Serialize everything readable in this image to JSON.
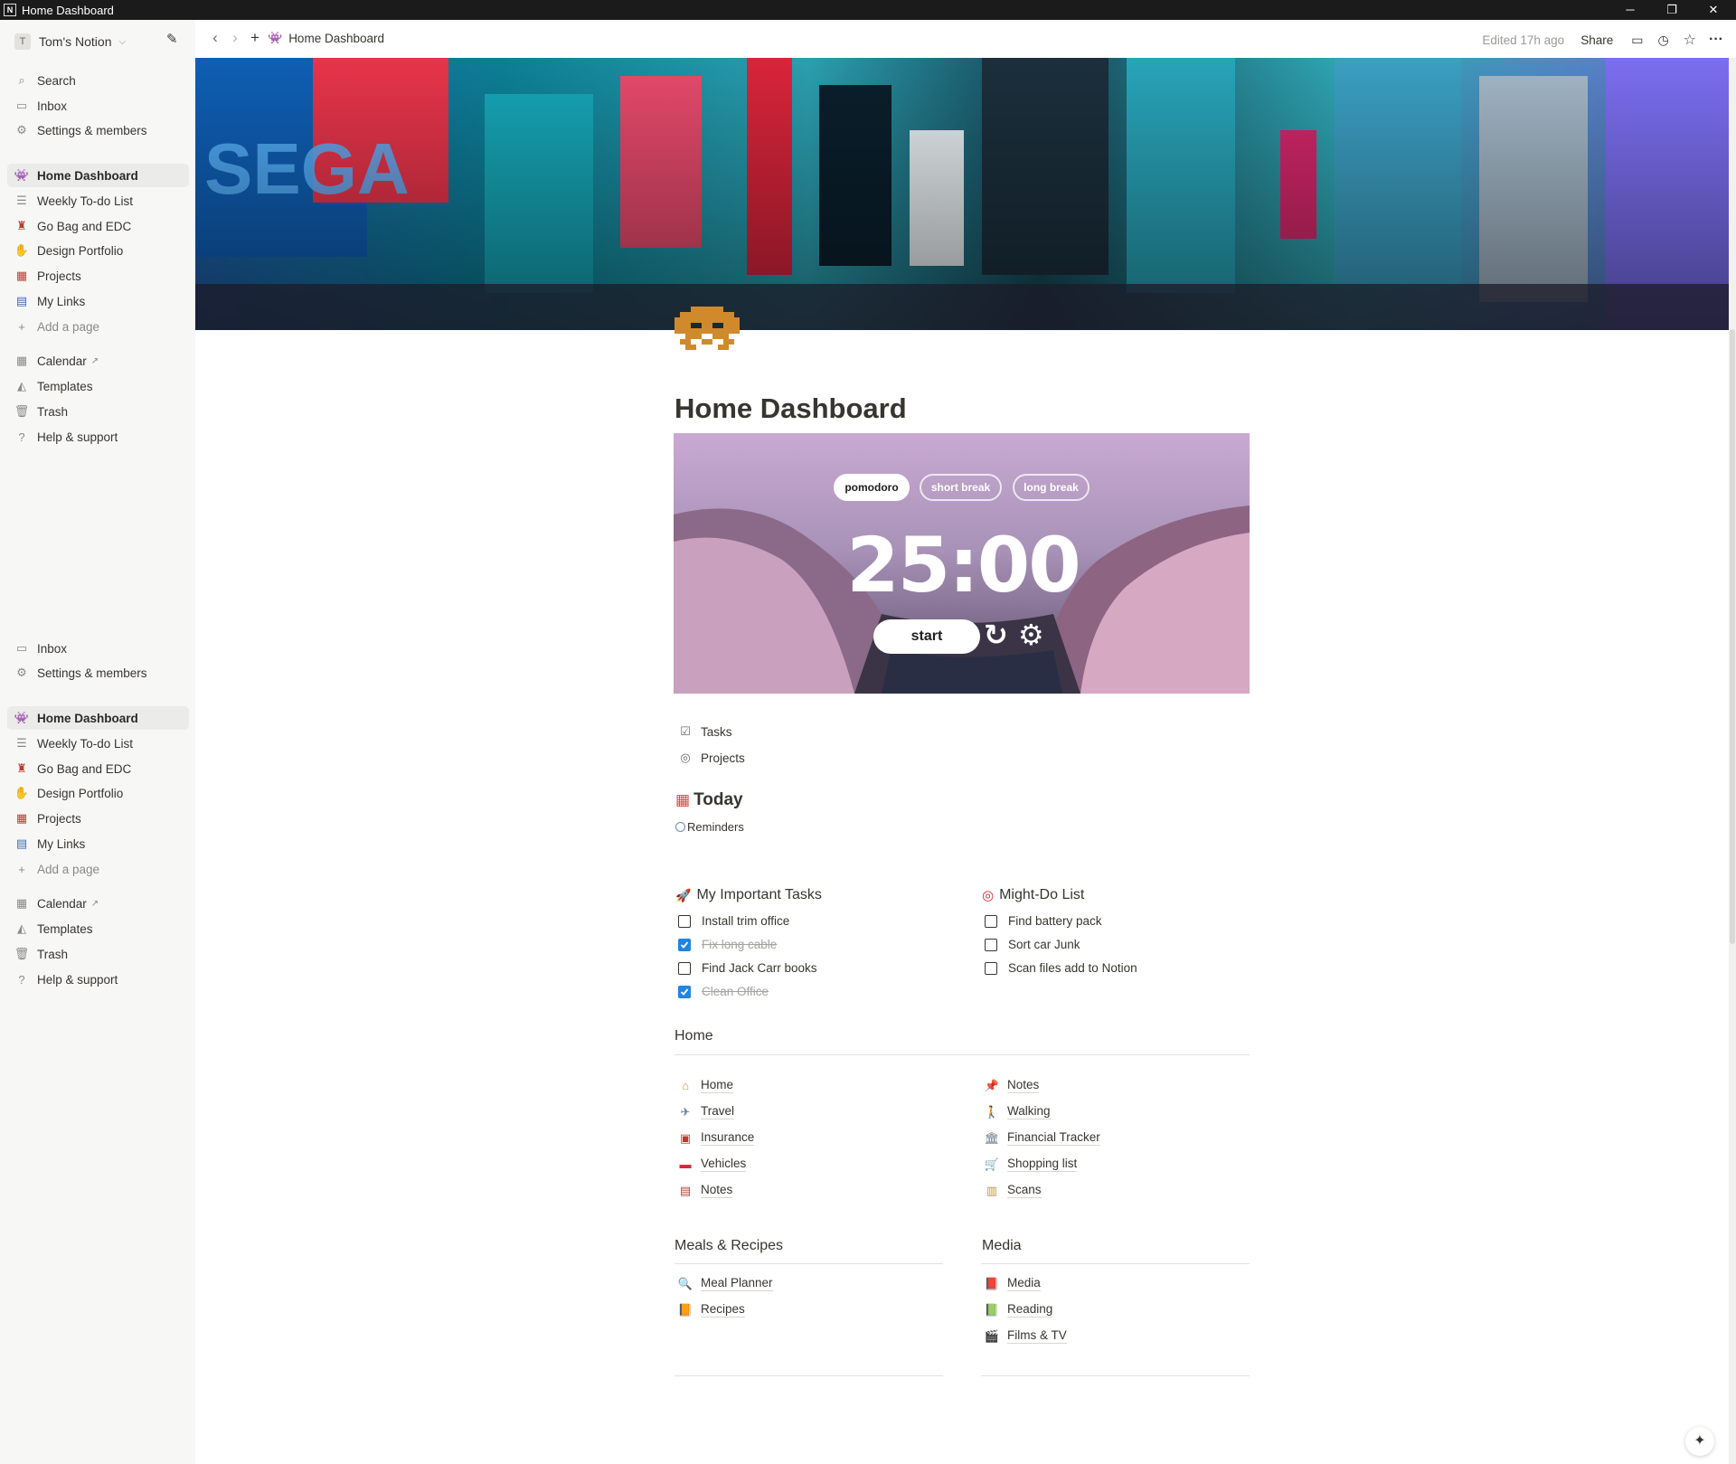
{
  "window": {
    "title": "Home Dashboard",
    "minimize": "─",
    "restore": "❐",
    "close": "✕"
  },
  "sidebar": {
    "workspace": "Tom's Notion",
    "workspace_initial": "T",
    "top": [
      {
        "label": "Search",
        "icon": "search-icon"
      },
      {
        "label": "Inbox",
        "icon": "inbox-icon"
      },
      {
        "label": "Settings & members",
        "icon": "gear-icon"
      }
    ],
    "pages": [
      {
        "label": "Home Dashboard",
        "icon": "space-invader-icon",
        "active": true
      },
      {
        "label": "Weekly To-do List",
        "icon": "list-icon"
      },
      {
        "label": "Go Bag and EDC",
        "icon": "backpack-icon"
      },
      {
        "label": "Design Portfolio",
        "icon": "hand-icon"
      },
      {
        "label": "Projects",
        "icon": "projects-icon"
      },
      {
        "label": "My Links",
        "icon": "links-icon"
      },
      {
        "label": "Add a page",
        "icon": "plus-icon"
      }
    ],
    "bottom": [
      {
        "label": "Calendar",
        "icon": "calendar-icon"
      },
      {
        "label": "Templates",
        "icon": "templates-icon"
      },
      {
        "label": "Trash",
        "icon": "trash-icon"
      },
      {
        "label": "Help & support",
        "icon": "help-icon"
      }
    ],
    "top2": [
      {
        "label": "Inbox",
        "icon": "inbox-icon"
      },
      {
        "label": "Settings & members",
        "icon": "gear-icon"
      }
    ]
  },
  "topbar": {
    "breadcrumb": "Home Dashboard",
    "edited": "Edited 17h ago",
    "share": "Share"
  },
  "page": {
    "title": "Home Dashboard"
  },
  "pomodoro": {
    "modes": [
      "pomodoro",
      "short break",
      "long break"
    ],
    "time": "25:00",
    "start": "start"
  },
  "links_top": [
    {
      "label": "Tasks",
      "icon": "checkbox-icon"
    },
    {
      "label": "Projects",
      "icon": "target-icon"
    }
  ],
  "today": {
    "title": "Today",
    "reminders": "Reminders"
  },
  "important_tasks": {
    "title": "My Important Tasks",
    "items": [
      {
        "label": "Install trim office",
        "checked": false
      },
      {
        "label": "Fix long cable",
        "checked": true
      },
      {
        "label": "Find Jack Carr books",
        "checked": false
      },
      {
        "label": "Clean Office",
        "checked": true
      }
    ]
  },
  "might_do": {
    "title": "Might-Do List",
    "items": [
      {
        "label": "Find battery pack",
        "checked": false
      },
      {
        "label": "Sort car Junk",
        "checked": false
      },
      {
        "label": "Scan files add to Notion",
        "checked": false
      }
    ]
  },
  "home": {
    "title": "Home",
    "left": [
      {
        "label": "Home",
        "icon": "house-icon"
      },
      {
        "label": "Travel",
        "icon": "airplane-icon"
      },
      {
        "label": "Insurance",
        "icon": "briefcase-icon"
      },
      {
        "label": "Vehicles",
        "icon": "car-icon"
      },
      {
        "label": "Notes",
        "icon": "notebook-icon"
      }
    ],
    "right": [
      {
        "label": "Notes",
        "icon": "pushpin-icon"
      },
      {
        "label": "Walking",
        "icon": "walking-icon"
      },
      {
        "label": "Financial Tracker",
        "icon": "bank-icon"
      },
      {
        "label": "Shopping list",
        "icon": "cart-icon"
      },
      {
        "label": "Scans",
        "icon": "barcode-icon"
      }
    ]
  },
  "meals": {
    "title": "Meals & Recipes",
    "items": [
      {
        "label": "Meal Planner",
        "icon": "magnifier-icon"
      },
      {
        "label": "Recipes",
        "icon": "book-icon"
      }
    ]
  },
  "media": {
    "title": "Media",
    "items": [
      {
        "label": "Media",
        "icon": "red-book-icon"
      },
      {
        "label": "Reading",
        "icon": "green-book-icon"
      },
      {
        "label": "Films & TV",
        "icon": "clapper-icon"
      }
    ]
  }
}
